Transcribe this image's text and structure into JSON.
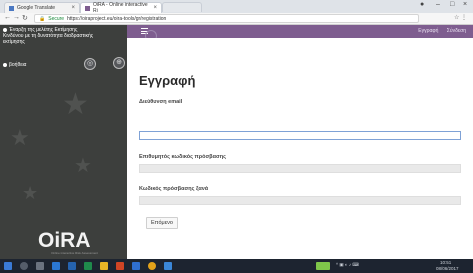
{
  "browser": {
    "tabs": [
      {
        "label": "Google Translate"
      },
      {
        "label": "OiRA - Online interactive Ri"
      }
    ],
    "url": "https://oiraproject.eu/oira-tools/gr/registration",
    "url_secure_label": "Secure"
  },
  "sidebar": {
    "intro": "Έναρξη της μελέτης Εκτίμησης Κινδύνου με τη δυνατότητα διαδραστικής εκτίμησης",
    "item": "βοήθεια",
    "logo": "OiRA",
    "logo_sub": "Online interactive Risk Assessment"
  },
  "topbar": {
    "links": [
      "Εγγραφή",
      "Σύνδεση"
    ]
  },
  "form": {
    "title": "Εγγραφή",
    "email_label": "Διεύθυνση email",
    "password_label": "Επιθυμητός κωδικός πρόσβασης",
    "password_repeat_label": "Κωδικός πρόσβασης ξανά",
    "next_button": "Επόμενο"
  },
  "taskbar": {
    "time": "10:51",
    "date": "08/06/2017"
  }
}
